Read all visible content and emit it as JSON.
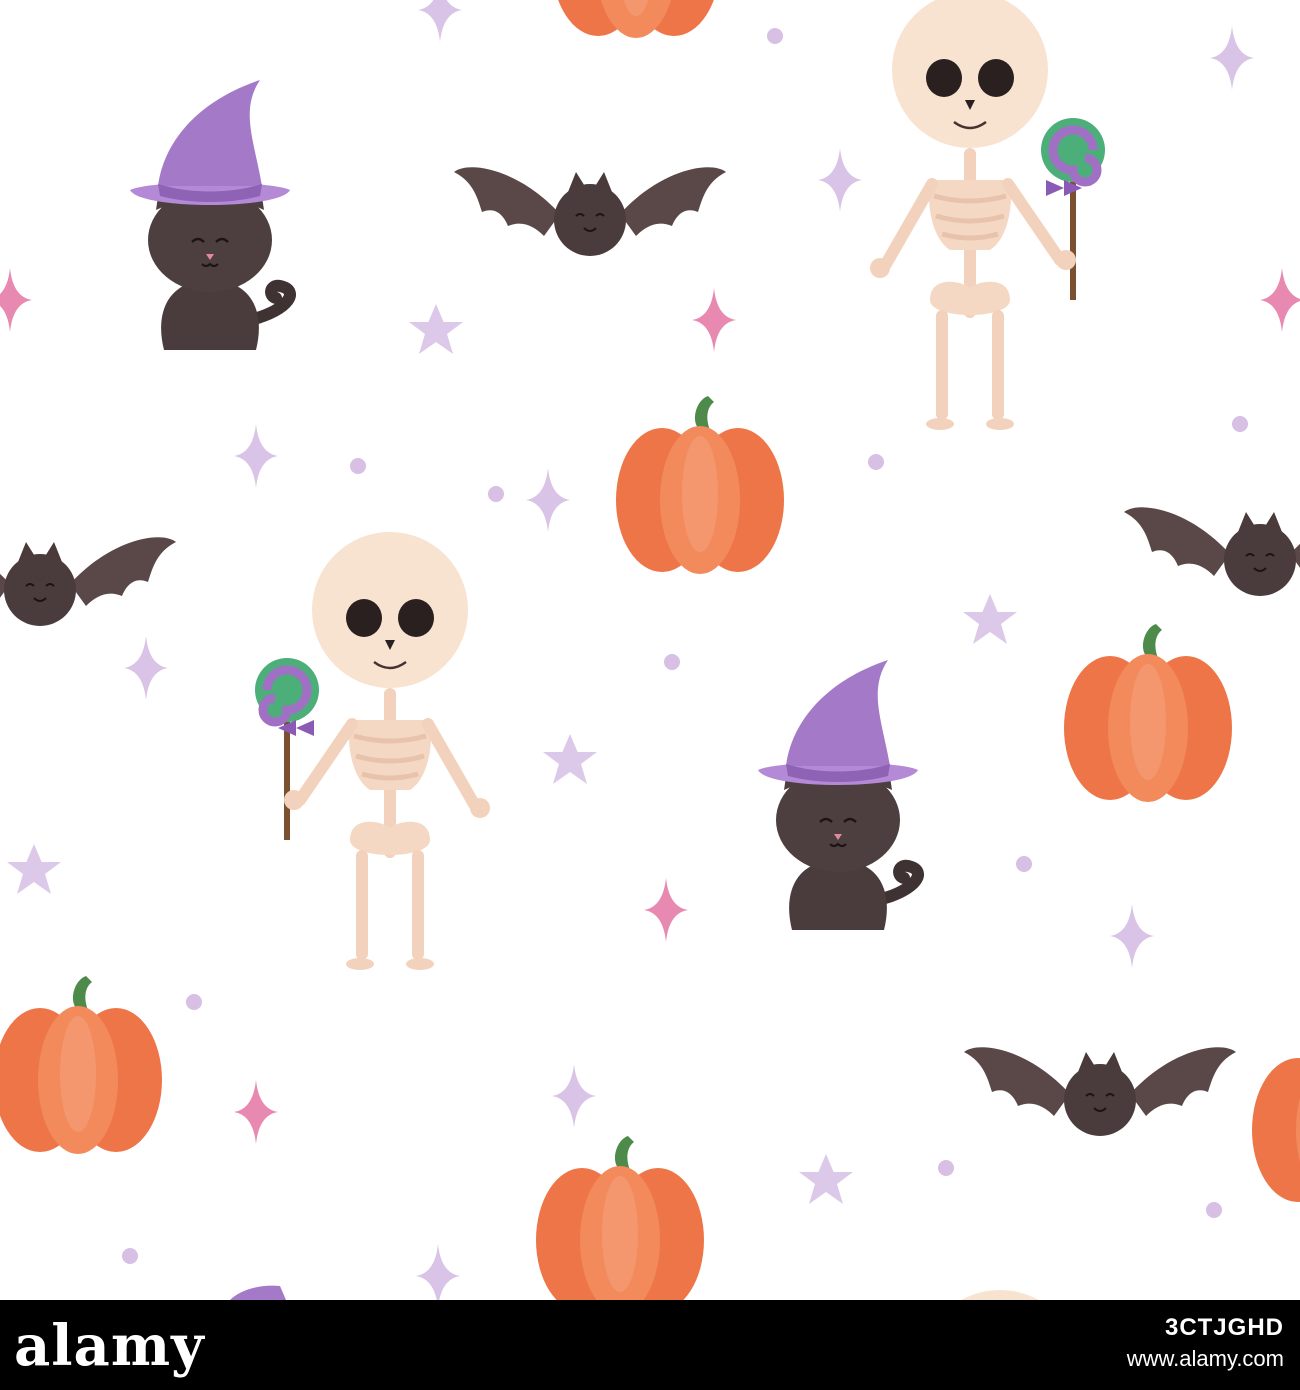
{
  "footer": {
    "logo_text": "alamy",
    "image_id": "3CTJGHD",
    "site": "www.alamy.com"
  },
  "colors": {
    "background": "#ffffff",
    "footer": "#000000",
    "pumpkin": "#f07a52",
    "pumpkin_stem": "#4e8a4a",
    "cat": "#4a3c3c",
    "hat": "#a47ac8",
    "bat": "#4d3f3f",
    "bone": "#f6dcc6",
    "star": "#d9c3e6",
    "sparkle_pink": "#e889b2",
    "lollipop_green": "#4caf7a",
    "lollipop_purple": "#a070c4"
  },
  "icons": [
    "cat-with-witch-hat",
    "bat",
    "skeleton-with-lollipop",
    "pumpkin",
    "star",
    "sparkle",
    "dot"
  ]
}
